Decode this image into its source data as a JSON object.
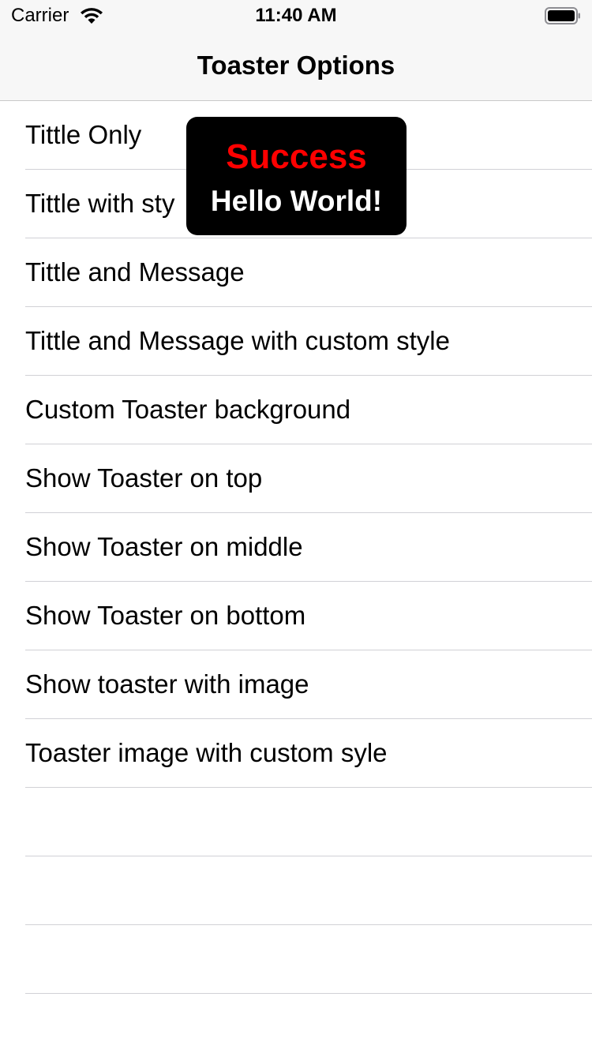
{
  "status_bar": {
    "carrier": "Carrier",
    "time": "11:40 AM",
    "wifi_icon": "wifi-icon",
    "battery_icon": "battery-icon"
  },
  "nav": {
    "title": "Toaster Options"
  },
  "table": {
    "rows": [
      {
        "label": "Tittle Only"
      },
      {
        "label": "Tittle with sty"
      },
      {
        "label": "Tittle and Message"
      },
      {
        "label": "Tittle and Message with custom style"
      },
      {
        "label": "Custom Toaster background"
      },
      {
        "label": "Show Toaster on top"
      },
      {
        "label": "Show Toaster on middle"
      },
      {
        "label": "Show Toaster on bottom"
      },
      {
        "label": "Show toaster with image"
      },
      {
        "label": "Toaster image with custom syle"
      },
      {
        "label": ""
      },
      {
        "label": ""
      },
      {
        "label": ""
      }
    ]
  },
  "toast": {
    "title": "Success",
    "message": "Hello World!",
    "title_color": "#ff0000",
    "message_color": "#ffffff",
    "background": "#000000"
  }
}
